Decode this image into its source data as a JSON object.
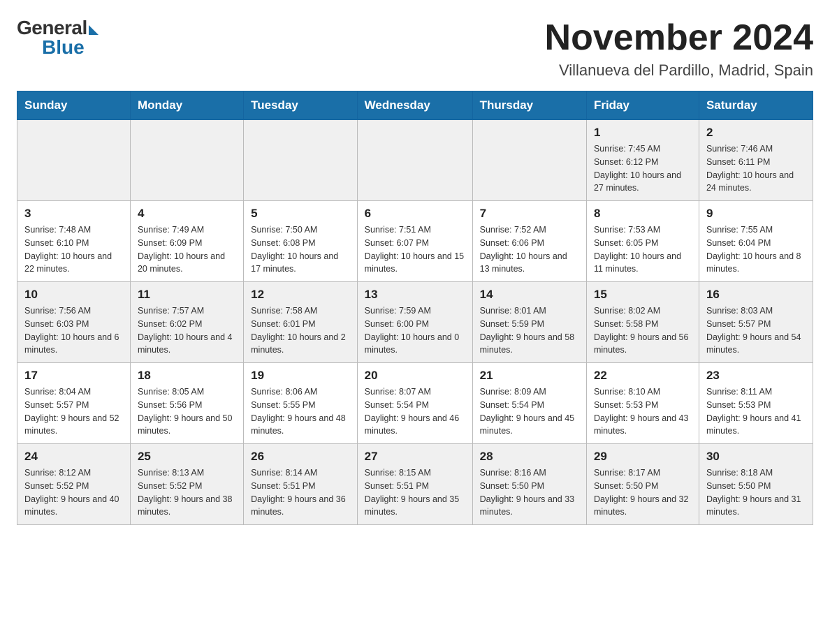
{
  "logo": {
    "general": "General",
    "blue": "Blue"
  },
  "header": {
    "month": "November 2024",
    "location": "Villanueva del Pardillo, Madrid, Spain"
  },
  "days_of_week": [
    "Sunday",
    "Monday",
    "Tuesday",
    "Wednesday",
    "Thursday",
    "Friday",
    "Saturday"
  ],
  "weeks": [
    {
      "days": [
        {
          "number": "",
          "info": ""
        },
        {
          "number": "",
          "info": ""
        },
        {
          "number": "",
          "info": ""
        },
        {
          "number": "",
          "info": ""
        },
        {
          "number": "",
          "info": ""
        },
        {
          "number": "1",
          "info": "Sunrise: 7:45 AM\nSunset: 6:12 PM\nDaylight: 10 hours and 27 minutes."
        },
        {
          "number": "2",
          "info": "Sunrise: 7:46 AM\nSunset: 6:11 PM\nDaylight: 10 hours and 24 minutes."
        }
      ]
    },
    {
      "days": [
        {
          "number": "3",
          "info": "Sunrise: 7:48 AM\nSunset: 6:10 PM\nDaylight: 10 hours and 22 minutes."
        },
        {
          "number": "4",
          "info": "Sunrise: 7:49 AM\nSunset: 6:09 PM\nDaylight: 10 hours and 20 minutes."
        },
        {
          "number": "5",
          "info": "Sunrise: 7:50 AM\nSunset: 6:08 PM\nDaylight: 10 hours and 17 minutes."
        },
        {
          "number": "6",
          "info": "Sunrise: 7:51 AM\nSunset: 6:07 PM\nDaylight: 10 hours and 15 minutes."
        },
        {
          "number": "7",
          "info": "Sunrise: 7:52 AM\nSunset: 6:06 PM\nDaylight: 10 hours and 13 minutes."
        },
        {
          "number": "8",
          "info": "Sunrise: 7:53 AM\nSunset: 6:05 PM\nDaylight: 10 hours and 11 minutes."
        },
        {
          "number": "9",
          "info": "Sunrise: 7:55 AM\nSunset: 6:04 PM\nDaylight: 10 hours and 8 minutes."
        }
      ]
    },
    {
      "days": [
        {
          "number": "10",
          "info": "Sunrise: 7:56 AM\nSunset: 6:03 PM\nDaylight: 10 hours and 6 minutes."
        },
        {
          "number": "11",
          "info": "Sunrise: 7:57 AM\nSunset: 6:02 PM\nDaylight: 10 hours and 4 minutes."
        },
        {
          "number": "12",
          "info": "Sunrise: 7:58 AM\nSunset: 6:01 PM\nDaylight: 10 hours and 2 minutes."
        },
        {
          "number": "13",
          "info": "Sunrise: 7:59 AM\nSunset: 6:00 PM\nDaylight: 10 hours and 0 minutes."
        },
        {
          "number": "14",
          "info": "Sunrise: 8:01 AM\nSunset: 5:59 PM\nDaylight: 9 hours and 58 minutes."
        },
        {
          "number": "15",
          "info": "Sunrise: 8:02 AM\nSunset: 5:58 PM\nDaylight: 9 hours and 56 minutes."
        },
        {
          "number": "16",
          "info": "Sunrise: 8:03 AM\nSunset: 5:57 PM\nDaylight: 9 hours and 54 minutes."
        }
      ]
    },
    {
      "days": [
        {
          "number": "17",
          "info": "Sunrise: 8:04 AM\nSunset: 5:57 PM\nDaylight: 9 hours and 52 minutes."
        },
        {
          "number": "18",
          "info": "Sunrise: 8:05 AM\nSunset: 5:56 PM\nDaylight: 9 hours and 50 minutes."
        },
        {
          "number": "19",
          "info": "Sunrise: 8:06 AM\nSunset: 5:55 PM\nDaylight: 9 hours and 48 minutes."
        },
        {
          "number": "20",
          "info": "Sunrise: 8:07 AM\nSunset: 5:54 PM\nDaylight: 9 hours and 46 minutes."
        },
        {
          "number": "21",
          "info": "Sunrise: 8:09 AM\nSunset: 5:54 PM\nDaylight: 9 hours and 45 minutes."
        },
        {
          "number": "22",
          "info": "Sunrise: 8:10 AM\nSunset: 5:53 PM\nDaylight: 9 hours and 43 minutes."
        },
        {
          "number": "23",
          "info": "Sunrise: 8:11 AM\nSunset: 5:53 PM\nDaylight: 9 hours and 41 minutes."
        }
      ]
    },
    {
      "days": [
        {
          "number": "24",
          "info": "Sunrise: 8:12 AM\nSunset: 5:52 PM\nDaylight: 9 hours and 40 minutes."
        },
        {
          "number": "25",
          "info": "Sunrise: 8:13 AM\nSunset: 5:52 PM\nDaylight: 9 hours and 38 minutes."
        },
        {
          "number": "26",
          "info": "Sunrise: 8:14 AM\nSunset: 5:51 PM\nDaylight: 9 hours and 36 minutes."
        },
        {
          "number": "27",
          "info": "Sunrise: 8:15 AM\nSunset: 5:51 PM\nDaylight: 9 hours and 35 minutes."
        },
        {
          "number": "28",
          "info": "Sunrise: 8:16 AM\nSunset: 5:50 PM\nDaylight: 9 hours and 33 minutes."
        },
        {
          "number": "29",
          "info": "Sunrise: 8:17 AM\nSunset: 5:50 PM\nDaylight: 9 hours and 32 minutes."
        },
        {
          "number": "30",
          "info": "Sunrise: 8:18 AM\nSunset: 5:50 PM\nDaylight: 9 hours and 31 minutes."
        }
      ]
    }
  ]
}
